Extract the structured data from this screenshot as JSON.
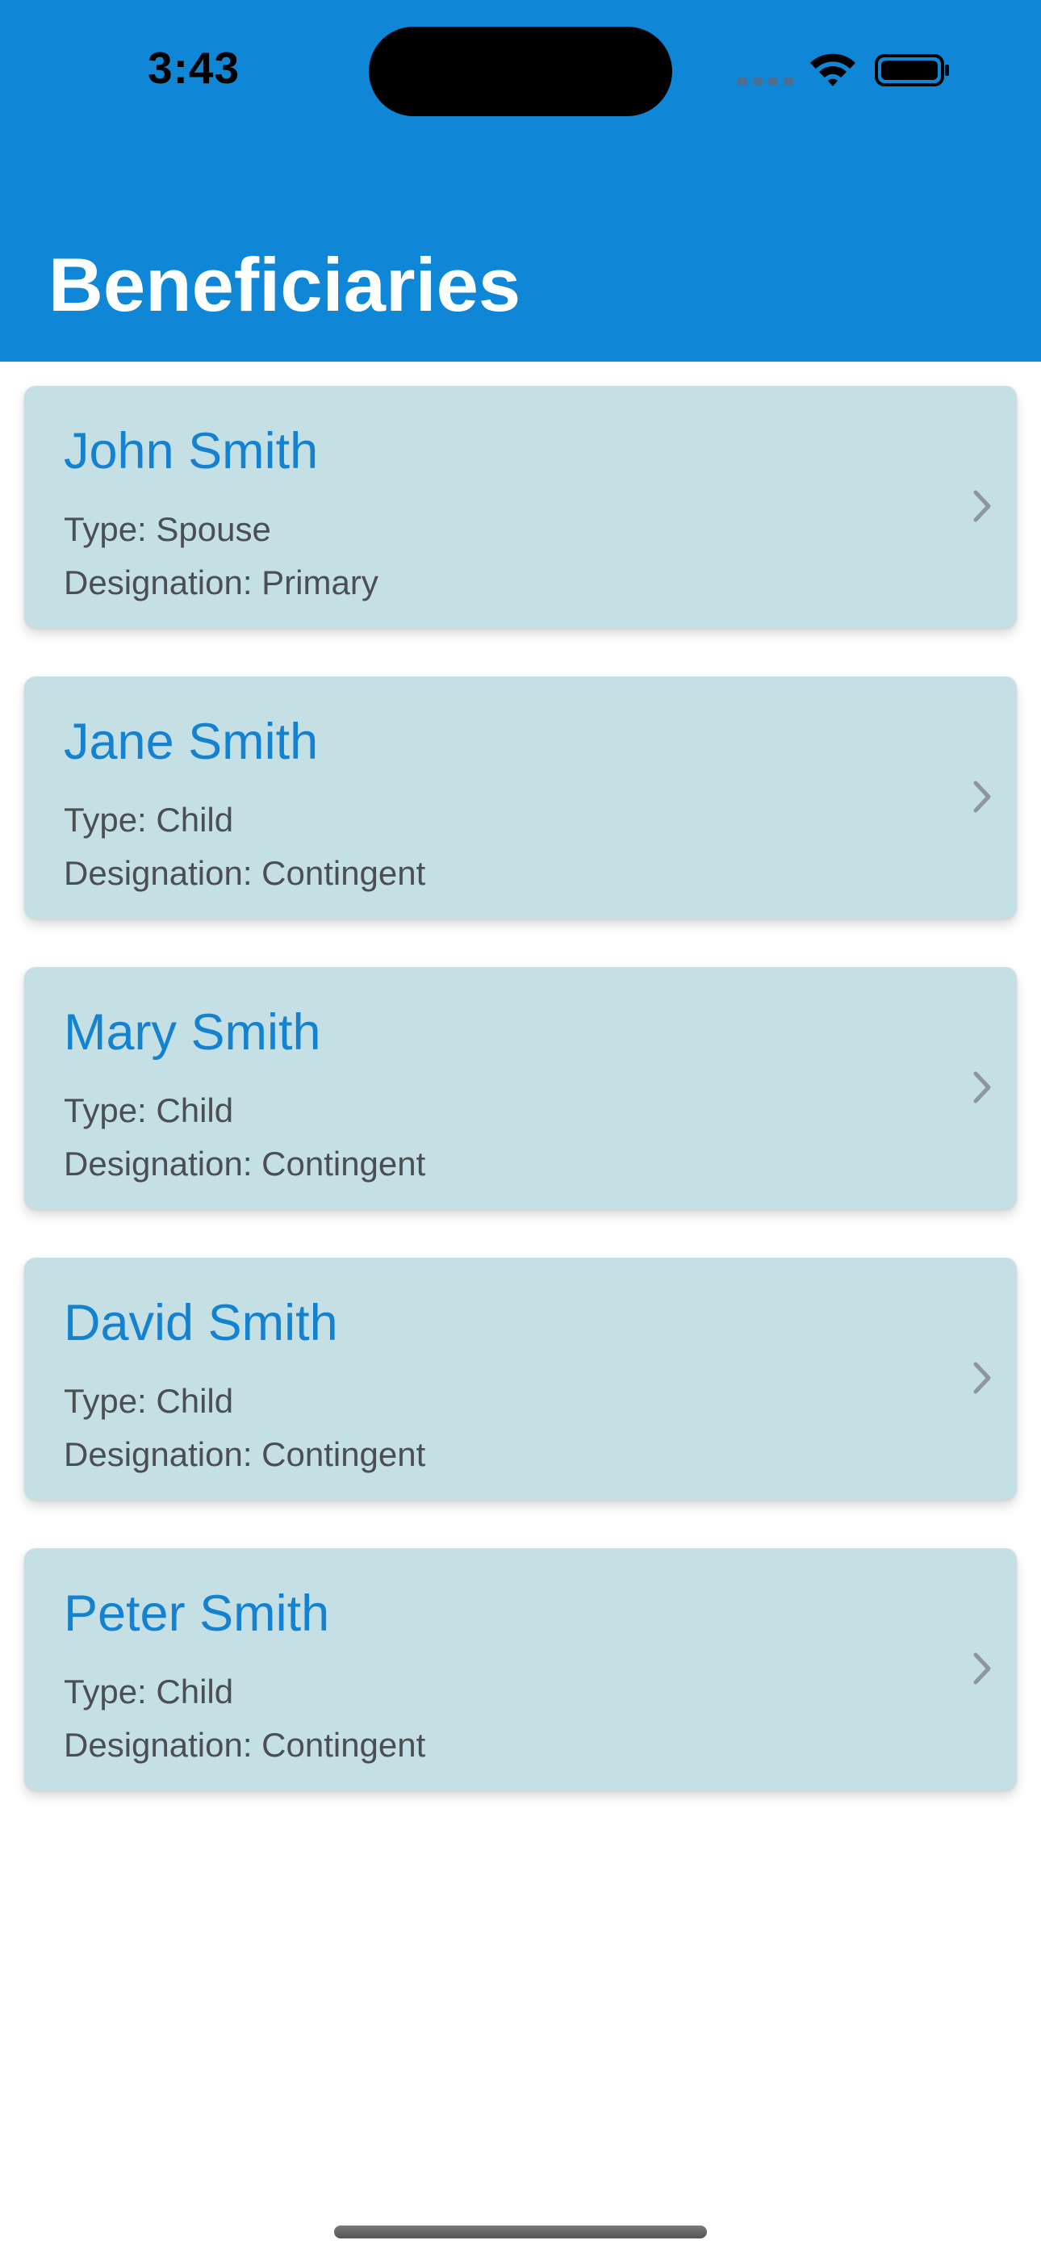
{
  "status_bar": {
    "time": "3:43"
  },
  "header": {
    "title": "Beneficiaries",
    "background_color": "#0f87d6"
  },
  "beneficiaries": [
    {
      "name": "John Smith",
      "type": "Type: Spouse",
      "designation": "Designation: Primary"
    },
    {
      "name": "Jane Smith",
      "type": "Type: Child",
      "designation": "Designation: Contingent"
    },
    {
      "name": "Mary Smith",
      "type": "Type: Child",
      "designation": "Designation: Contingent"
    },
    {
      "name": "David Smith",
      "type": "Type: Child",
      "designation": "Designation: Contingent"
    },
    {
      "name": "Peter Smith",
      "type": "Type: Child",
      "designation": "Designation: Contingent"
    }
  ],
  "colors": {
    "card_background": "#c4e0e5",
    "name_text": "#1482d0",
    "detail_text": "#4b4f54"
  },
  "icons": {
    "row_disclosure": "chevron-right-icon",
    "status": [
      "cellular-signal-icon",
      "wifi-icon",
      "battery-icon"
    ]
  }
}
